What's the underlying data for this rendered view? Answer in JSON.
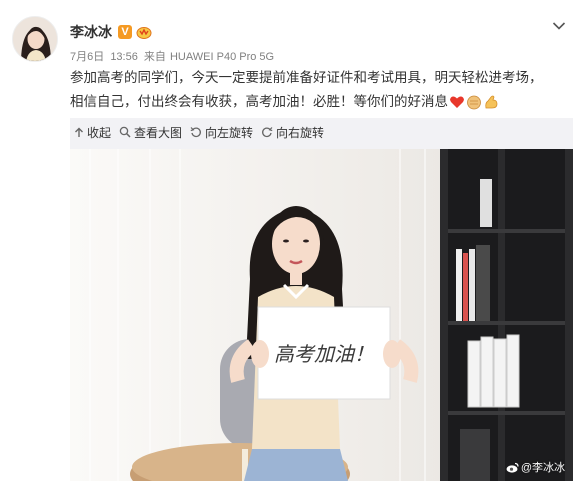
{
  "post": {
    "author": "李冰冰",
    "verified_badge": "V",
    "date": "7月6日",
    "time": "13:56",
    "source_prefix": "来自",
    "device": "HUAWEI P40 Pro 5G",
    "text_line1": "参加高考的同学们，今天一定要提前准备好证件和考试用具，明天轻松进考场，",
    "text_line2": "相信自己，付出终会有收获，高考加油！必胜！等你们的好消息"
  },
  "toolbar": {
    "collapse": "收起",
    "view_large": "查看大图",
    "rotate_left": "向左旋转",
    "rotate_right": "向右旋转"
  },
  "photo": {
    "sign_text": "高考加油！",
    "watermark": "@李冰冰"
  },
  "colors": {
    "verified": "#f59a23",
    "heart": "#e8372b",
    "panel_bg": "#f2f2f5"
  },
  "icons": [
    "more-chevron-icon",
    "collapse-arrow-icon",
    "magnify-icon",
    "rotate-left-icon",
    "rotate-right-icon",
    "heart-emoji",
    "fist-emoji",
    "strong-arm-emoji",
    "weibo-logo-icon"
  ]
}
